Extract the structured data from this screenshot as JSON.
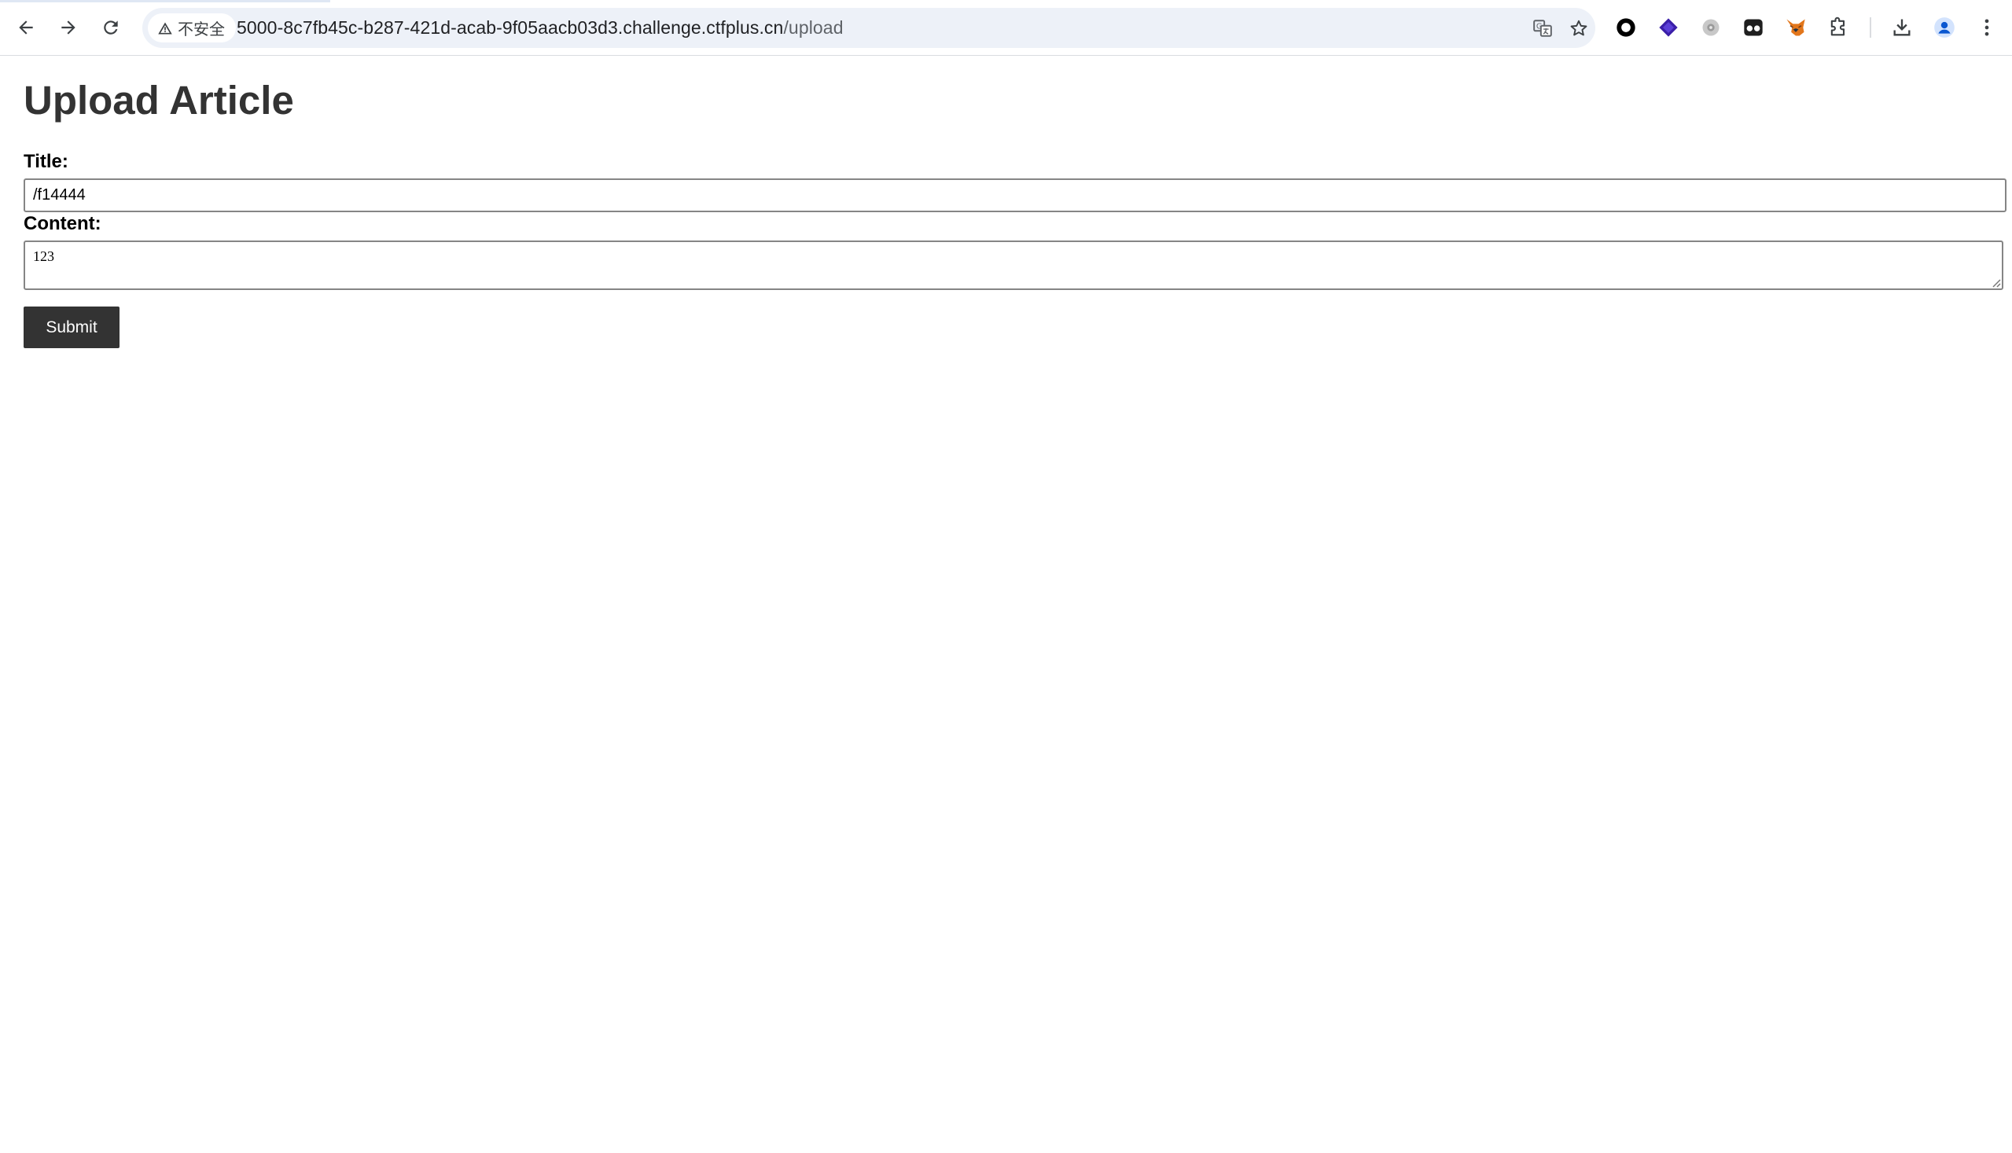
{
  "browser": {
    "security_label": "不安全",
    "url_host": "5000-8c7fb45c-b287-421d-acab-9f05aacb03d3.challenge.ctfplus.cn",
    "url_path": "/upload",
    "icons": {
      "back": "arrow-left-icon",
      "forward": "arrow-right-icon",
      "reload": "reload-icon",
      "warning": "warning-triangle-icon",
      "translate": "translate-icon",
      "bookmark": "star-icon",
      "extensions": [
        "circle-extension-icon",
        "purple-diamond-extension-icon",
        "gray-settings-extension-icon",
        "dark-glasses-extension-icon",
        "fox-extension-icon",
        "puzzle-icon"
      ],
      "download": "download-icon",
      "profile": "profile-avatar-icon",
      "menu": "kebab-menu-icon"
    }
  },
  "page": {
    "heading": "Upload Article",
    "title_label": "Title:",
    "title_value": "/f14444",
    "content_label": "Content:",
    "content_value": "123",
    "submit_label": "Submit"
  },
  "colors": {
    "heading": "#333333",
    "submit_bg": "#333333",
    "omnibox_bg": "#edf1f8"
  }
}
